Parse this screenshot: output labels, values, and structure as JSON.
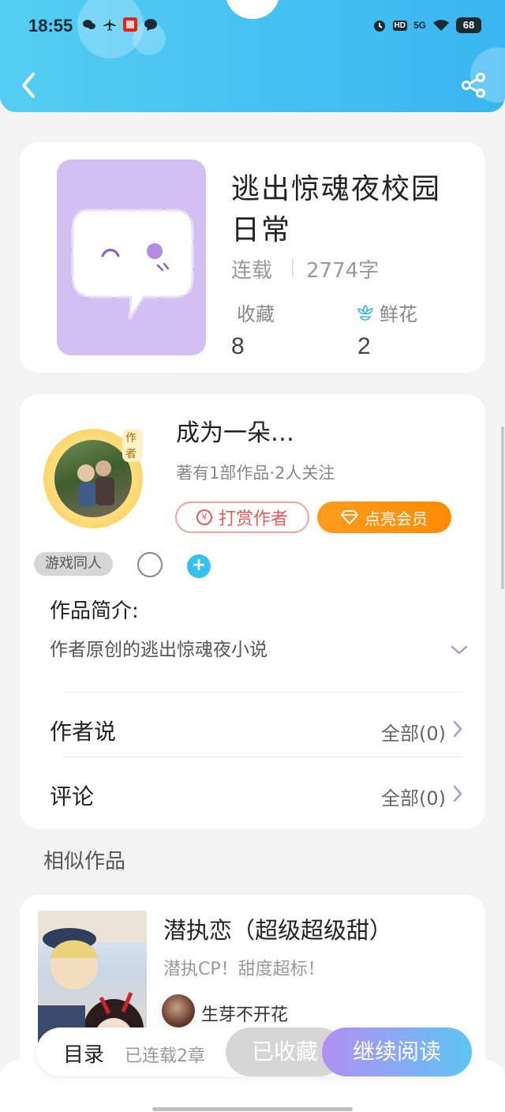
{
  "status_bar": {
    "time": "18:55",
    "battery": "68",
    "net_label": "5G",
    "hd_label": "HD"
  },
  "book": {
    "title": "逃出惊魂夜校园日常",
    "status": "连载",
    "words": "2774字",
    "collect_label": "收藏",
    "collect_count": "8",
    "flower_label": "鲜花",
    "flower_count": "2"
  },
  "author": {
    "name": "成为一朵…",
    "meta": "著有1部作品·2人关注",
    "avatar_tag": "作者",
    "reward_label": "打赏作者",
    "reward_coin": "¥",
    "vip_label": "点亮会员",
    "tag": "游戏同人",
    "plus": "+"
  },
  "intro": {
    "title": "作品简介:",
    "text": "作者原创的逃出惊魂夜小说"
  },
  "rows": [
    {
      "label": "作者说",
      "right": "全部(0)"
    },
    {
      "label": "评论",
      "right": "全部(0)"
    }
  ],
  "similar": {
    "section_title": "相似作品",
    "title": "潜执恋（超级超级甜）",
    "desc": "潜执CP！甜度超标！",
    "author": "生芽不开花"
  },
  "bottom_bar": {
    "toc_label": "目录",
    "toc_count": "已连载2章",
    "fav_label": "已收藏",
    "read_label": "继续阅读"
  },
  "colors": {
    "header": "#3ab6f0",
    "cover_bg": "#d3c0f3",
    "reward": "#e55a5a",
    "vip": "#ff8a00",
    "accent": "#36c2f0"
  },
  "icons": [
    "back-arrow-icon",
    "share-icon",
    "flower-icon",
    "diamond-icon",
    "chevron-right-icon",
    "chevron-down-icon",
    "chat-bubble-icon"
  ]
}
